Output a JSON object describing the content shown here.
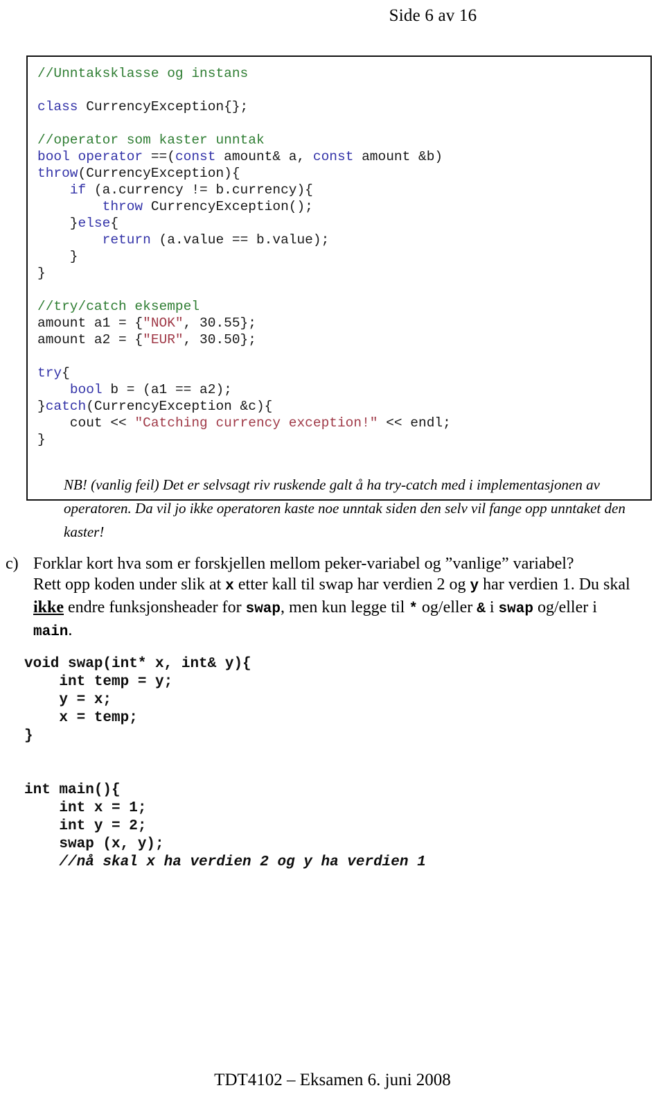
{
  "header": {
    "page_label": "Side 6 av 16"
  },
  "footer": {
    "text": "TDT4102 – Eksamen 6. juni 2008"
  },
  "colors": {
    "comment": "#2E7D32",
    "keyword": "#3333A8",
    "string": "#A03A48",
    "plain": "#161616",
    "box_border": "#111111",
    "page_background": "#FFFFFF"
  },
  "code_box": {
    "language": "cpp",
    "lines": [
      [
        {
          "t": "//Unntaksklasse og instans",
          "c": "cm"
        }
      ],
      [],
      [
        {
          "t": "class",
          "c": "kw"
        },
        {
          "t": " CurrencyException{};",
          "c": "pl"
        }
      ],
      [],
      [
        {
          "t": "//operator som kaster unntak",
          "c": "cm"
        }
      ],
      [
        {
          "t": "bool operator ",
          "c": "kw"
        },
        {
          "t": "==(",
          "c": "pl"
        },
        {
          "t": "const",
          "c": "kw"
        },
        {
          "t": " amount& a, ",
          "c": "pl"
        },
        {
          "t": "const",
          "c": "kw"
        },
        {
          "t": " amount &b)",
          "c": "pl"
        }
      ],
      [
        {
          "t": "throw",
          "c": "kw"
        },
        {
          "t": "(CurrencyException){",
          "c": "pl"
        }
      ],
      [
        {
          "t": "    ",
          "c": "pl"
        },
        {
          "t": "if",
          "c": "kw"
        },
        {
          "t": " (a.currency != b.currency){",
          "c": "pl"
        }
      ],
      [
        {
          "t": "        ",
          "c": "pl"
        },
        {
          "t": "throw",
          "c": "kw"
        },
        {
          "t": " CurrencyException();",
          "c": "pl"
        }
      ],
      [
        {
          "t": "    }",
          "c": "pl"
        },
        {
          "t": "else",
          "c": "kw"
        },
        {
          "t": "{",
          "c": "pl"
        }
      ],
      [
        {
          "t": "        ",
          "c": "pl"
        },
        {
          "t": "return",
          "c": "kw"
        },
        {
          "t": " (a.value == b.value);",
          "c": "pl"
        }
      ],
      [
        {
          "t": "    }",
          "c": "pl"
        }
      ],
      [
        {
          "t": "}",
          "c": "pl"
        }
      ],
      [],
      [
        {
          "t": "//try/catch eksempel",
          "c": "cm"
        }
      ],
      [
        {
          "t": "amount a1 = {",
          "c": "pl"
        },
        {
          "t": "\"NOK\"",
          "c": "st"
        },
        {
          "t": ", 30.55};",
          "c": "pl"
        }
      ],
      [
        {
          "t": "amount a2 = {",
          "c": "pl"
        },
        {
          "t": "\"EUR\"",
          "c": "st"
        },
        {
          "t": ", 30.50};",
          "c": "pl"
        }
      ],
      [],
      [
        {
          "t": "try",
          "c": "kw"
        },
        {
          "t": "{",
          "c": "pl"
        }
      ],
      [
        {
          "t": "    ",
          "c": "pl"
        },
        {
          "t": "bool",
          "c": "kw"
        },
        {
          "t": " b = (a1 == a2);",
          "c": "pl"
        }
      ],
      [
        {
          "t": "}",
          "c": "pl"
        },
        {
          "t": "catch",
          "c": "kw"
        },
        {
          "t": "(CurrencyException &c){",
          "c": "pl"
        }
      ],
      [
        {
          "t": "    cout << ",
          "c": "pl"
        },
        {
          "t": "\"Catching currency exception!\"",
          "c": "st"
        },
        {
          "t": " << endl;",
          "c": "pl"
        }
      ],
      [
        {
          "t": "}",
          "c": "pl"
        }
      ]
    ],
    "note_lines": [
      "NB! (vanlig feil) Det er selvsagt riv ruskende galt å ha try-catch med i implementasjonen av",
      "operatoren. Da vil jo ikke operatoren kaste noe unntak siden den selv vil fange opp unntaket den",
      "kaster!"
    ]
  },
  "question": {
    "marker": "c)",
    "line1": "Forklar kort hva som er forskjellen mellom peker-variabel og ”vanlige” variabel?",
    "line2_a": "Rett opp koden under slik at ",
    "line2_x": "x",
    "line2_b": " etter kall til swap har verdien 2 og ",
    "line2_y": "y",
    "line2_c": " har verdien 1.  Du skal",
    "line3_ikke": "ikke",
    "line3_a": " endre funksjonsheader for ",
    "line3_swap1": "swap",
    "line3_b": ", men kun legge til ",
    "line3_star": "*",
    "line3_c": " og/eller ",
    "line3_amp": "&",
    "line3_d": " i ",
    "line3_swap2": "swap",
    "line3_e": " og/eller i",
    "line4_main": "main",
    "line4_dot": "."
  },
  "code_listing": {
    "language": "cpp",
    "lines": [
      {
        "text": "void swap(int* x, int& y){",
        "style": "plain"
      },
      {
        "text": "    int temp = y;",
        "style": "plain"
      },
      {
        "text": "    y = x;",
        "style": "plain"
      },
      {
        "text": "    x = temp;",
        "style": "plain"
      },
      {
        "text": "}",
        "style": "plain"
      },
      {
        "text": "",
        "style": "blank"
      },
      {
        "text": "",
        "style": "blank"
      },
      {
        "text": "int main(){",
        "style": "plain"
      },
      {
        "text": "    int x = 1;",
        "style": "plain"
      },
      {
        "text": "    int y = 2;",
        "style": "plain"
      },
      {
        "text": "    swap (x, y);",
        "style": "plain"
      },
      {
        "text": "    //nå skal x ha verdien 2 og y ha verdien 1",
        "style": "comment-italic"
      }
    ]
  }
}
